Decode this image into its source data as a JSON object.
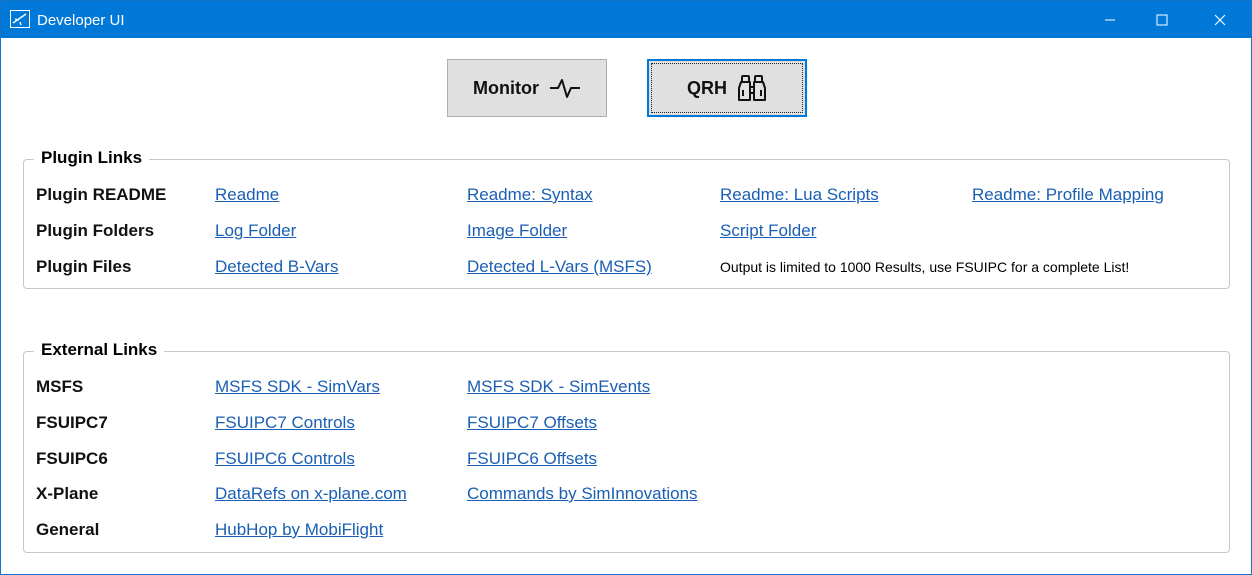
{
  "window": {
    "title": "Developer UI"
  },
  "toolbar": {
    "monitor_label": "Monitor",
    "monitor_icon": "pulse-icon",
    "qrh_label": "QRH",
    "qrh_icon": "binoculars-icon"
  },
  "plugin_links": {
    "title": "Plugin Links",
    "rows": [
      {
        "label": "Plugin README",
        "links": [
          "Readme",
          "Readme: Syntax",
          "Readme: Lua Scripts",
          "Readme: Profile Mapping"
        ]
      },
      {
        "label": "Plugin Folders",
        "links": [
          "Log Folder",
          "Image Folder",
          "Script Folder"
        ]
      },
      {
        "label": "Plugin Files",
        "links": [
          "Detected B-Vars",
          "Detected L-Vars (MSFS)"
        ],
        "note": "Output is limited to 1000 Results, use FSUIPC for a complete List!"
      }
    ]
  },
  "external_links": {
    "title": "External Links",
    "rows": [
      {
        "label": "MSFS",
        "links": [
          "MSFS SDK - SimVars",
          "MSFS SDK - SimEvents"
        ]
      },
      {
        "label": "FSUIPC7",
        "links": [
          "FSUIPC7 Controls",
          "FSUIPC7 Offsets"
        ]
      },
      {
        "label": "FSUIPC6",
        "links": [
          "FSUIPC6 Controls",
          "FSUIPC6 Offsets"
        ]
      },
      {
        "label": "X-Plane",
        "links": [
          "DataRefs on x-plane.com",
          "Commands by SimInnovations"
        ]
      },
      {
        "label": "General",
        "links": [
          "HubHop by MobiFlight"
        ]
      }
    ]
  },
  "colors": {
    "titlebar": "#0078d7",
    "link": "#1a5fb4",
    "button_bg": "#e0e0e0"
  }
}
